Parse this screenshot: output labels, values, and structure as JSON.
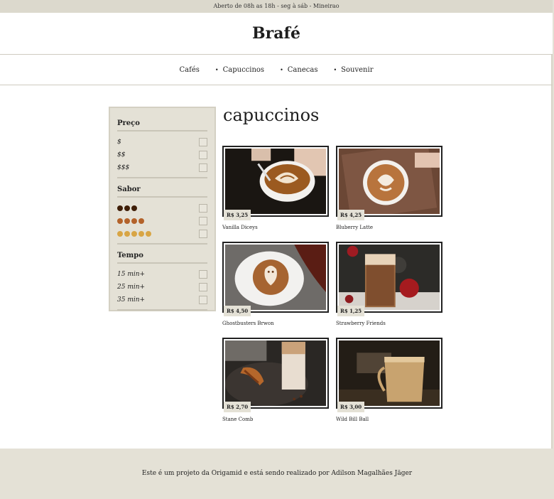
{
  "topbar": {
    "text": "Aberto de 08h as 18h - seg à sáb - Mineirao"
  },
  "brand": {
    "logo": "Brafé"
  },
  "nav": {
    "items": [
      {
        "label": "Cafés"
      },
      {
        "label": "Capuccinos"
      },
      {
        "label": "Canecas"
      },
      {
        "label": "Souvenir"
      }
    ]
  },
  "sidebar": {
    "groups": [
      {
        "title": "Preço",
        "options": [
          "$",
          "$$",
          "$$$"
        ]
      },
      {
        "title": "Sabor",
        "options": [
          "●●●",
          "●●●●",
          "●●●●●"
        ]
      },
      {
        "title": "Tempo",
        "options": [
          "15 min+",
          "25 min+",
          "35 min+"
        ]
      }
    ],
    "flavor_colors": [
      "#3f1e08",
      "#b3622a",
      "#d8a545"
    ]
  },
  "main": {
    "title": "capuccinos"
  },
  "products": [
    {
      "price": "R$ 3,25",
      "name": "Vanilla Diceys"
    },
    {
      "price": "R$ 4,25",
      "name": "Bluberry Latte"
    },
    {
      "price": "R$ 4,50",
      "name": "Ghostbusters Brwon"
    },
    {
      "price": "R$ 1,25",
      "name": "Strawberry Friends"
    },
    {
      "price": "R$ 2,70",
      "name": "Stane Comb"
    },
    {
      "price": "R$ 3,00",
      "name": "Wild Bill Ball"
    }
  ],
  "footer": {
    "text": "Este é um projeto da Origamid e está sendo realizado por Adilson Magalhães Jäger"
  }
}
